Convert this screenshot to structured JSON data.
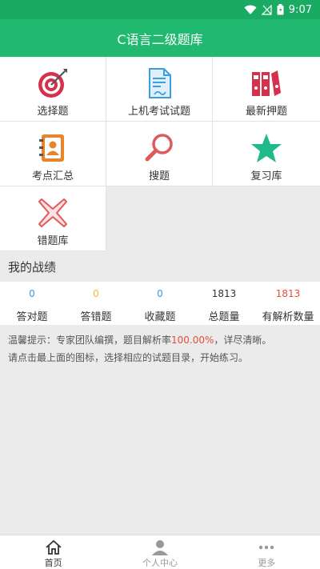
{
  "status_bar": {
    "time": "9:07"
  },
  "app_bar": {
    "title": "C语言二级题库"
  },
  "grid": [
    {
      "label": "选择题",
      "icon": "target-icon"
    },
    {
      "label": "上机考试试题",
      "icon": "document-pen-icon"
    },
    {
      "label": "最新押题",
      "icon": "binders-icon"
    },
    {
      "label": "考点汇总",
      "icon": "contact-book-icon"
    },
    {
      "label": "搜题",
      "icon": "magnifier-icon"
    },
    {
      "label": "复习库",
      "icon": "star-icon"
    },
    {
      "label": "错题库",
      "icon": "cross-icon"
    }
  ],
  "scores": {
    "title": "我的战绩",
    "items": [
      {
        "value": "0",
        "label": "答对题",
        "color": "#3a9ad9"
      },
      {
        "value": "0",
        "label": "答错题",
        "color": "#f5b63a"
      },
      {
        "value": "0",
        "label": "收藏题",
        "color": "#3a9ad9"
      },
      {
        "value": "1813",
        "label": "总题量",
        "color": "#333333"
      },
      {
        "value": "1813",
        "label": "有解析数量",
        "color": "#e74c3c"
      }
    ]
  },
  "tips": {
    "line1_prefix": "温馨提示：专家团队编撰，题目解析率",
    "line1_pct": "100.00%",
    "line1_suffix": "，详尽清晰。",
    "line2": "请点击最上面的图标，选择相应的试题目录，开始练习。"
  },
  "tabs": [
    {
      "label": "首页",
      "icon": "home-icon",
      "color": "#333333"
    },
    {
      "label": "个人中心",
      "icon": "person-icon",
      "color": "#999999"
    },
    {
      "label": "更多",
      "icon": "more-icon",
      "color": "#999999"
    }
  ]
}
